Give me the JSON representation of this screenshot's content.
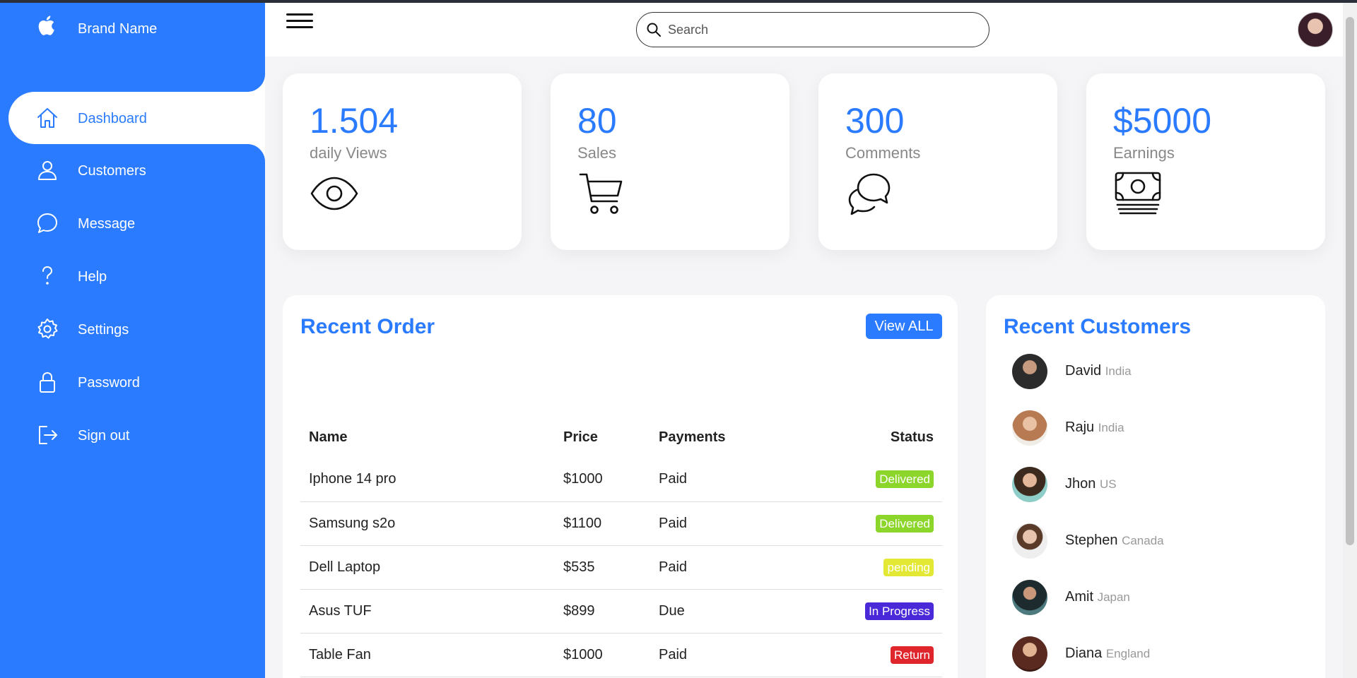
{
  "brand": {
    "name": "Brand Name",
    "icon": "apple-icon"
  },
  "sidebar": {
    "items": [
      {
        "label": "Dashboard",
        "icon": "home-icon",
        "active": true
      },
      {
        "label": "Customers",
        "icon": "person-icon"
      },
      {
        "label": "Message",
        "icon": "chat-icon"
      },
      {
        "label": "Help",
        "icon": "question-icon"
      },
      {
        "label": "Settings",
        "icon": "gear-icon"
      },
      {
        "label": "Password",
        "icon": "lock-icon"
      },
      {
        "label": "Sign out",
        "icon": "sign-out-icon"
      }
    ]
  },
  "search": {
    "placeholder": "Search"
  },
  "cards": [
    {
      "number": "1.504",
      "label": "daily Views",
      "icon": "eye-icon"
    },
    {
      "number": "80",
      "label": "Sales",
      "icon": "cart-icon"
    },
    {
      "number": "300",
      "label": "Comments",
      "icon": "comments-icon"
    },
    {
      "number": "$5000",
      "label": "Earnings",
      "icon": "money-icon"
    }
  ],
  "orders": {
    "title": "Recent Order",
    "view_all": "View ALL",
    "headers": [
      "Name",
      "Price",
      "Payments",
      "Status"
    ],
    "rows": [
      {
        "name": "Iphone 14 pro",
        "price": "$1000",
        "payment": "Paid",
        "status": "Delivered",
        "status_color": "#8cd52a"
      },
      {
        "name": "Samsung s2o",
        "price": "$1100",
        "payment": "Paid",
        "status": "Delivered",
        "status_color": "#8cd52a"
      },
      {
        "name": "Dell Laptop",
        "price": "$535",
        "payment": "Paid",
        "status": "pending",
        "status_color": "#e3e835"
      },
      {
        "name": "Asus TUF",
        "price": "$899",
        "payment": "Due",
        "status": "In Progress",
        "status_color": "#4a2ad8"
      },
      {
        "name": "Table Fan",
        "price": "$1000",
        "payment": "Paid",
        "status": "Return",
        "status_color": "#e0262d"
      }
    ]
  },
  "customers": {
    "title": "Recent Customers",
    "list": [
      {
        "name": "David",
        "country": "India"
      },
      {
        "name": "Raju",
        "country": "India"
      },
      {
        "name": "Jhon",
        "country": "US"
      },
      {
        "name": "Stephen",
        "country": "Canada"
      },
      {
        "name": "Amit",
        "country": "Japan"
      },
      {
        "name": "Diana",
        "country": "England"
      }
    ]
  },
  "colors": {
    "accent": "#2a7bff",
    "background": "#f5f5f7"
  }
}
